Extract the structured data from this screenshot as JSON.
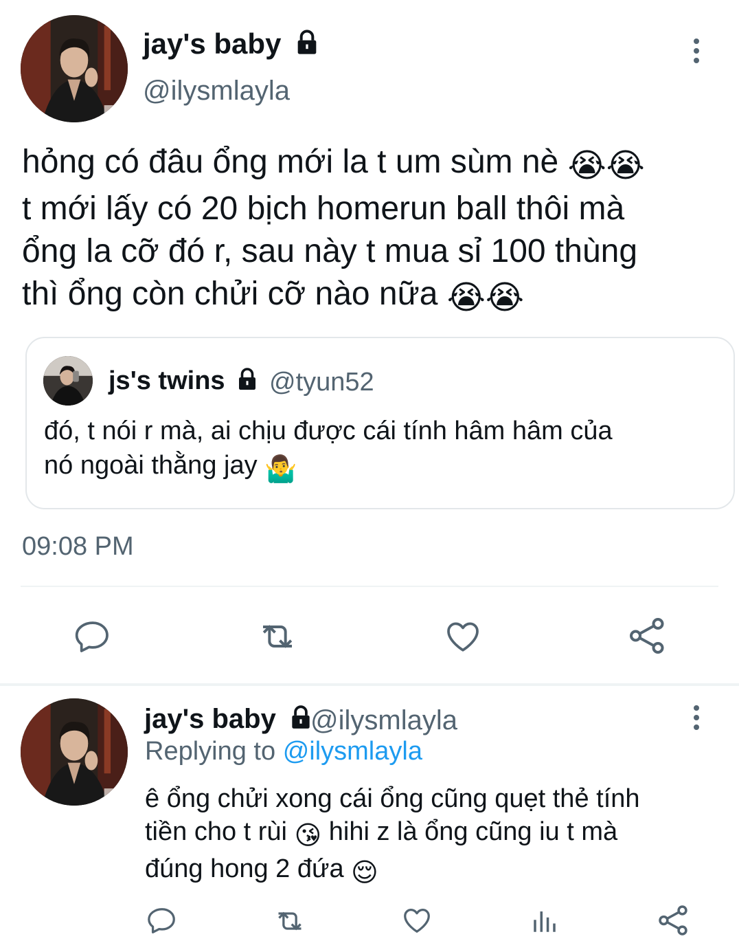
{
  "main_tweet": {
    "author_name": "jay's baby",
    "author_handle": "@ilysmlayla",
    "text_lines": [
      "hỏng có đâu ổng mới la t um sùm nè",
      "t mới lấy có 20 bịch homerun ball thôi mà",
      "ổng la cỡ đó r, sau này t mua sỉ 100 thùng",
      "thì ổng còn chửi cỡ nào nữa"
    ],
    "line1_emoji": "😭😭",
    "line4_emoji": "😭😭",
    "timestamp": "09:08 PM"
  },
  "quote": {
    "author_name": "js's twins",
    "author_handle": "@tyun52",
    "text_lines": [
      "đó, t nói r mà, ai chịu được cái tính hâm hâm của",
      "nó ngoài thằng jay"
    ],
    "line2_emoji": "🤷‍♂️"
  },
  "actions": {
    "icons": [
      "reply-icon",
      "retweet-icon",
      "like-icon",
      "share-icon"
    ]
  },
  "reply": {
    "author_name": "jay's baby",
    "author_handle": "@ilysmlayla",
    "replying_prefix": "Replying to",
    "replying_handle": "@ilysmlayla",
    "text_lines": [
      "ê ổng chửi xong cái ổng cũng quẹt thẻ tính",
      "tiền cho t rùi",
      "hihi z là ổng cũng iu t mà",
      "đúng hong 2 đứa"
    ],
    "line2_emoji": "😘",
    "line3_emoji": "😌",
    "icons": [
      "reply-icon",
      "retweet-icon",
      "like-icon",
      "analytics-icon",
      "share-icon"
    ]
  },
  "colors": {
    "text": "#0f1419",
    "secondary": "#536471",
    "link": "#1d9bf0",
    "divider": "#eff3f4"
  }
}
